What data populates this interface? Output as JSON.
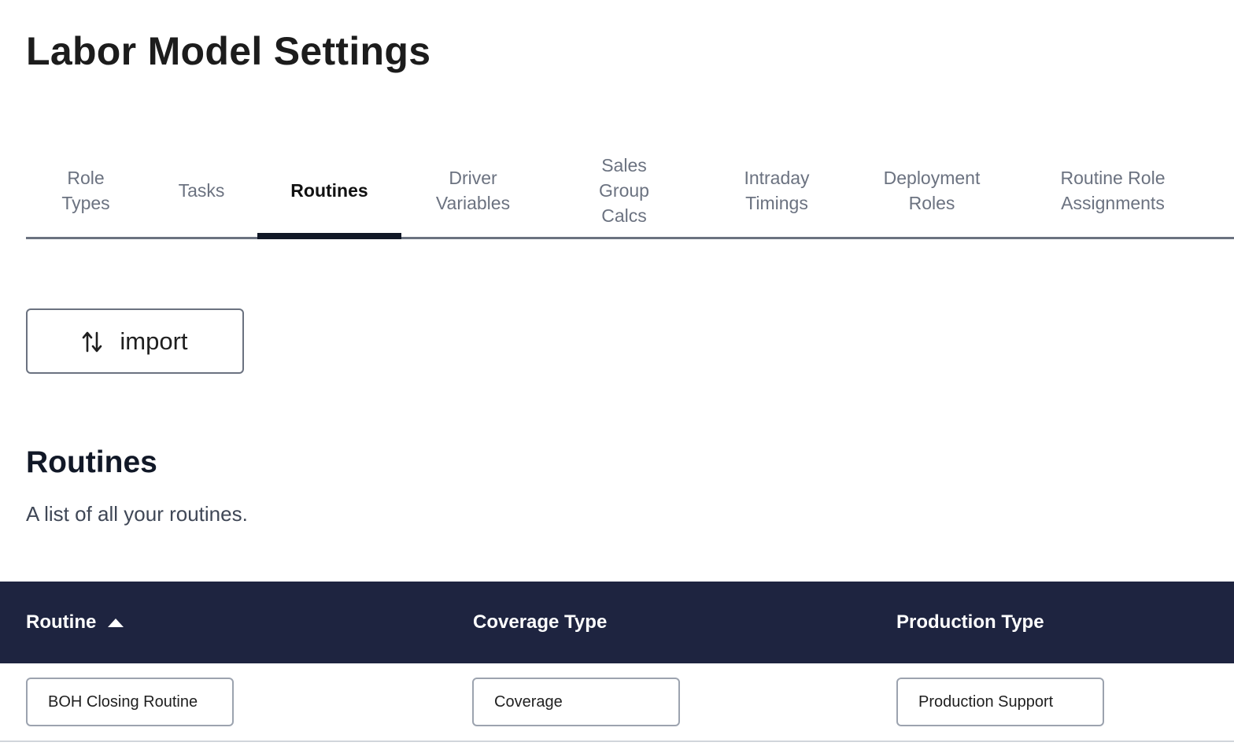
{
  "page": {
    "title": "Labor Model Settings"
  },
  "tabs": [
    {
      "label": "Role\nTypes",
      "active": false
    },
    {
      "label": "Tasks",
      "active": false
    },
    {
      "label": "Routines",
      "active": true
    },
    {
      "label": "Driver\nVariables",
      "active": false
    },
    {
      "label": "Sales\nGroup\nCalcs",
      "active": false
    },
    {
      "label": "Intraday\nTimings",
      "active": false
    },
    {
      "label": "Deployment\nRoles",
      "active": false
    },
    {
      "label": "Routine Role\nAssignments",
      "active": false
    }
  ],
  "toolbar": {
    "import_label": "import",
    "import_icon": "swap-vertical-icon"
  },
  "section": {
    "title": "Routines",
    "description": "A list of all your routines."
  },
  "table": {
    "columns": [
      {
        "label": "Routine",
        "sorted": "ascending",
        "sort_icon": "caret-up-icon"
      },
      {
        "label": "Coverage Type"
      },
      {
        "label": "Production Type"
      }
    ],
    "rows": [
      {
        "routine": "BOH Closing Routine",
        "coverage_type": "Coverage",
        "production_type": "Production Support"
      }
    ]
  },
  "colors": {
    "header_bg": "#1e2440",
    "active_tab_underline": "#111827",
    "inactive_tab_text": "#6b7280"
  }
}
